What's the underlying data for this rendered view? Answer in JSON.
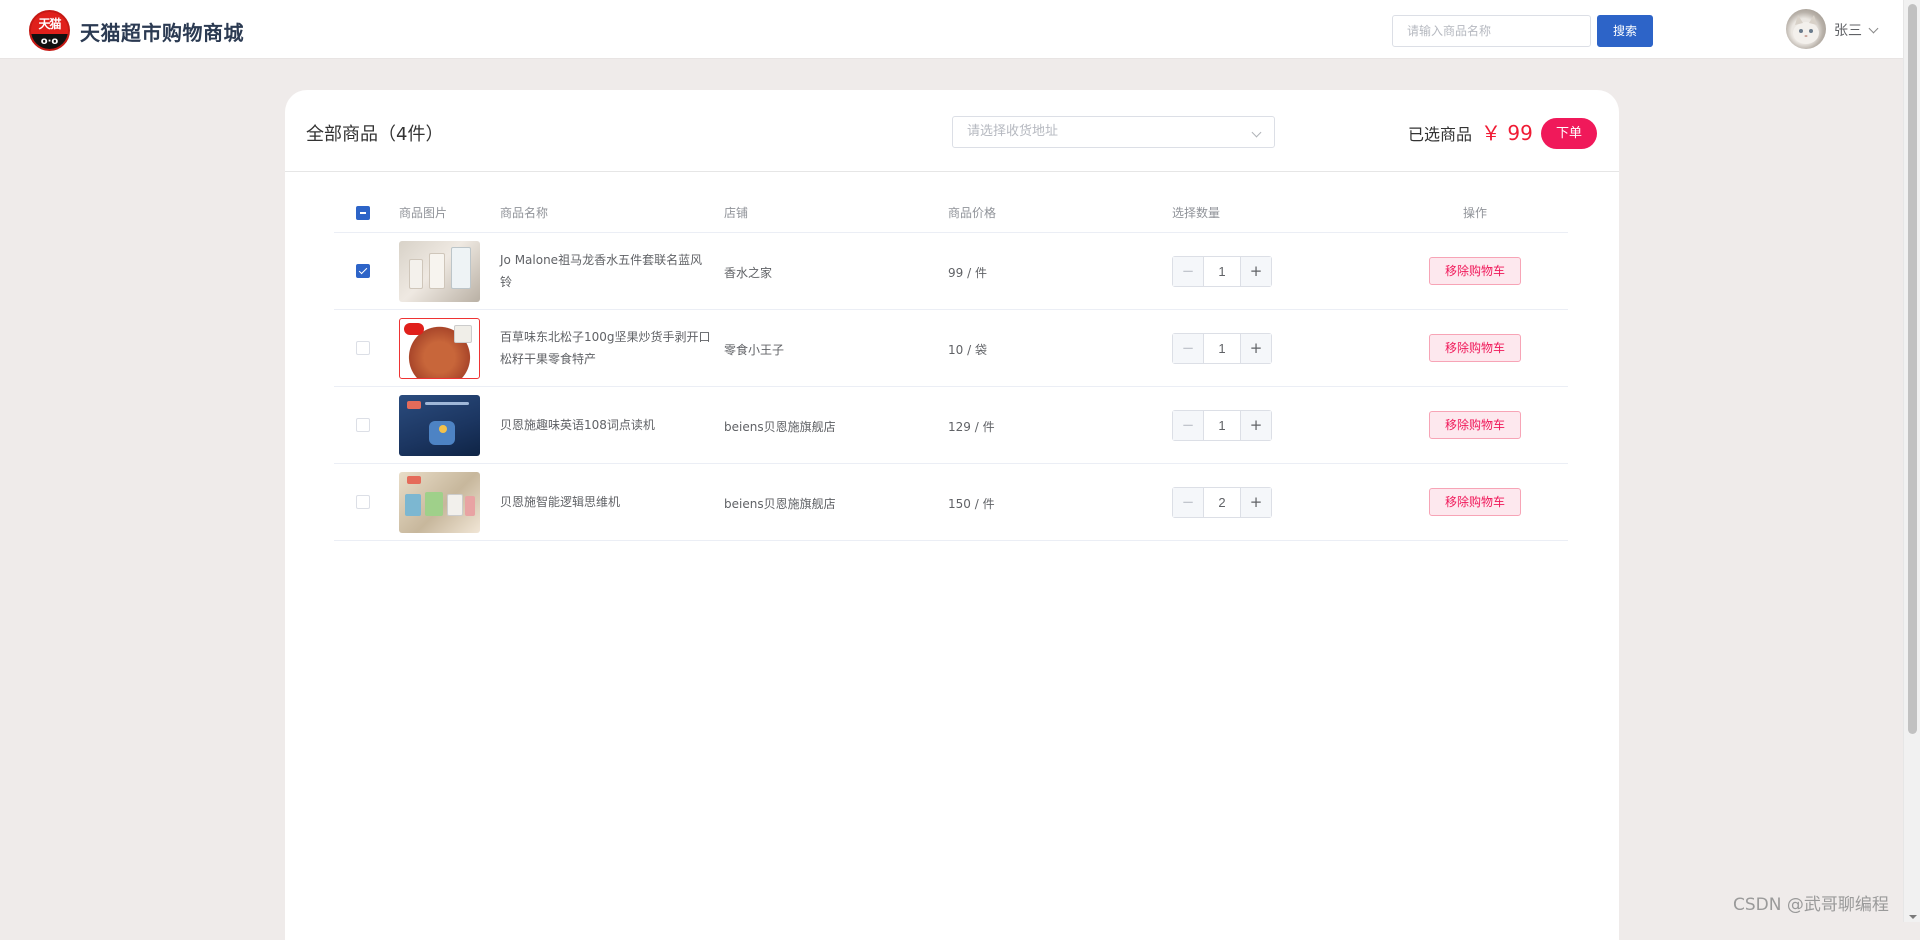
{
  "header": {
    "logo_text": "天猫",
    "logo_face": "o·o",
    "site_title": "天猫超市购物商城",
    "search_placeholder": "请输入商品名称",
    "search_button": "搜索",
    "username": "张三"
  },
  "cart": {
    "title": "全部商品（4件）",
    "address_placeholder": "请选择收货地址",
    "selected_label": "已选商品",
    "selected_price": "￥ 99",
    "order_button": "下单",
    "columns": [
      "商品图片",
      "商品名称",
      "店铺",
      "商品价格",
      "选择数量",
      "操作"
    ],
    "header_checkbox_state": "indeterminate",
    "rows": [
      {
        "checked": true,
        "name": "Jo Malone祖马龙香水五件套联名蓝风铃",
        "shop": "香水之家",
        "price": "99 / 件",
        "quantity": "1",
        "action": "移除购物车"
      },
      {
        "checked": false,
        "name": "百草味东北松子100g坚果炒货手剥开口松籽干果零食特产",
        "shop": "零食小王子",
        "price": "10 / 袋",
        "quantity": "1",
        "action": "移除购物车"
      },
      {
        "checked": false,
        "name": "贝恩施趣味英语108词点读机",
        "shop": "beiens贝恩施旗舰店",
        "price": "129 / 件",
        "quantity": "1",
        "action": "移除购物车"
      },
      {
        "checked": false,
        "name": "贝恩施智能逻辑思维机",
        "shop": "beiens贝恩施旗舰店",
        "price": "150 / 件",
        "quantity": "2",
        "action": "移除购物车"
      }
    ]
  },
  "watermark": "CSDN @武哥聊编程",
  "colors": {
    "primary": "#2d64c8",
    "accent": "#f0195a",
    "price_red": "#f01b34",
    "page_bg": "#efebea"
  },
  "icons": {
    "address_dropdown": "chevron-down-icon",
    "user_dropdown": "chevron-down-icon",
    "stepper_minus": "minus-icon",
    "stepper_plus": "plus-icon"
  }
}
